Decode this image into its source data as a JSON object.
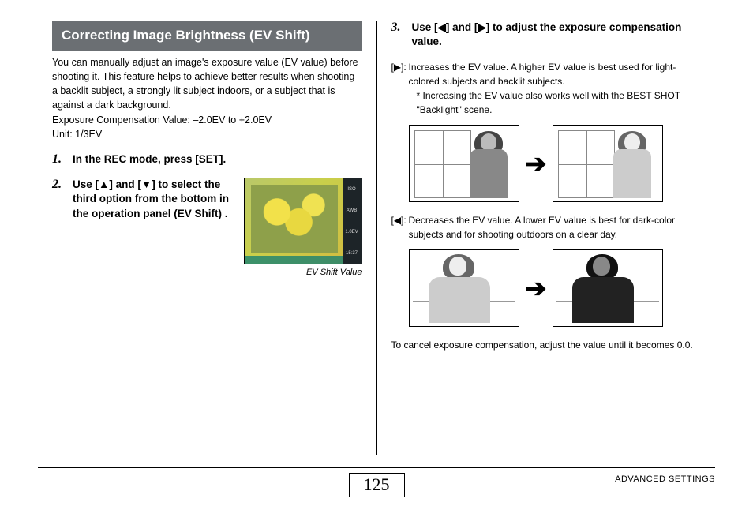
{
  "section_title": "Correcting Image Brightness (EV Shift)",
  "intro": {
    "p1": "You can manually adjust an image's exposure value (EV value) before shooting it. This feature helps to achieve better results when shooting a backlit subject, a strongly lit subject indoors, or a subject that is against a dark background.",
    "p2": "Exposure Compensation Value: –2.0EV to +2.0EV",
    "p3": "Unit: 1/3EV"
  },
  "steps": {
    "s1": {
      "num": "1.",
      "text": "In the REC mode, press [SET]."
    },
    "s2": {
      "num": "2.",
      "text_a": "Use [",
      "text_up": "▲",
      "text_b": "] and [",
      "text_down": "▼",
      "text_c": "] to select the third option from the bottom in the operation panel (EV Shift) ."
    },
    "s3": {
      "num": "3.",
      "text_a": "Use [",
      "text_left": "◀",
      "text_b": "] and [",
      "text_right": "▶",
      "text_c": "] to adjust the exposure compensation value."
    }
  },
  "thumb": {
    "caption": "EV Shift Value",
    "side": {
      "iso": "ISO",
      "awb": "AWB",
      "ev": "1.0EV",
      "time": "15:37"
    }
  },
  "right": {
    "inc_key": "[▶]:",
    "inc_text": "Increases the EV value. A higher EV value is best used for light-colored subjects and backlit subjects.",
    "inc_note": "* Increasing the EV value also works well with the BEST SHOT \"Backlight\" scene.",
    "dec_key": "[◀]:",
    "dec_text": "Decreases the EV value. A lower EV value is best for dark-color subjects and for shooting outdoors on a clear day.",
    "cancel": "To cancel exposure compensation, adjust the value until it becomes 0.0."
  },
  "arrow": "➔",
  "footer": {
    "page": "125",
    "label": "ADVANCED SETTINGS"
  }
}
